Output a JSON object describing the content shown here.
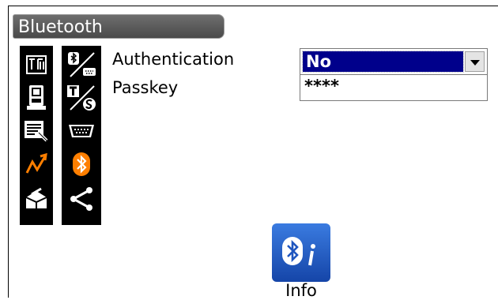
{
  "screen": {
    "title": "Bluetooth"
  },
  "sidebar": {
    "left_icons": [
      "measure-tabs-icon",
      "instrument-icon",
      "edit-data-icon",
      "trend-icon",
      "box-icon"
    ],
    "right_icons": [
      "bluetooth-rs232-icon",
      "t-s-icon",
      "serial-port-icon",
      "bluetooth-icon",
      "share-icon"
    ],
    "accent_color": "#ff7f00"
  },
  "form": {
    "authentication_label": "Authentication",
    "passkey_label": "Passkey",
    "authentication_value": "No",
    "passkey_value": "****"
  },
  "softkeys": {
    "info_label": "Info"
  },
  "colors": {
    "selection": "#00008b",
    "title_bar": "#555555",
    "info_button": "#2a62c8"
  }
}
